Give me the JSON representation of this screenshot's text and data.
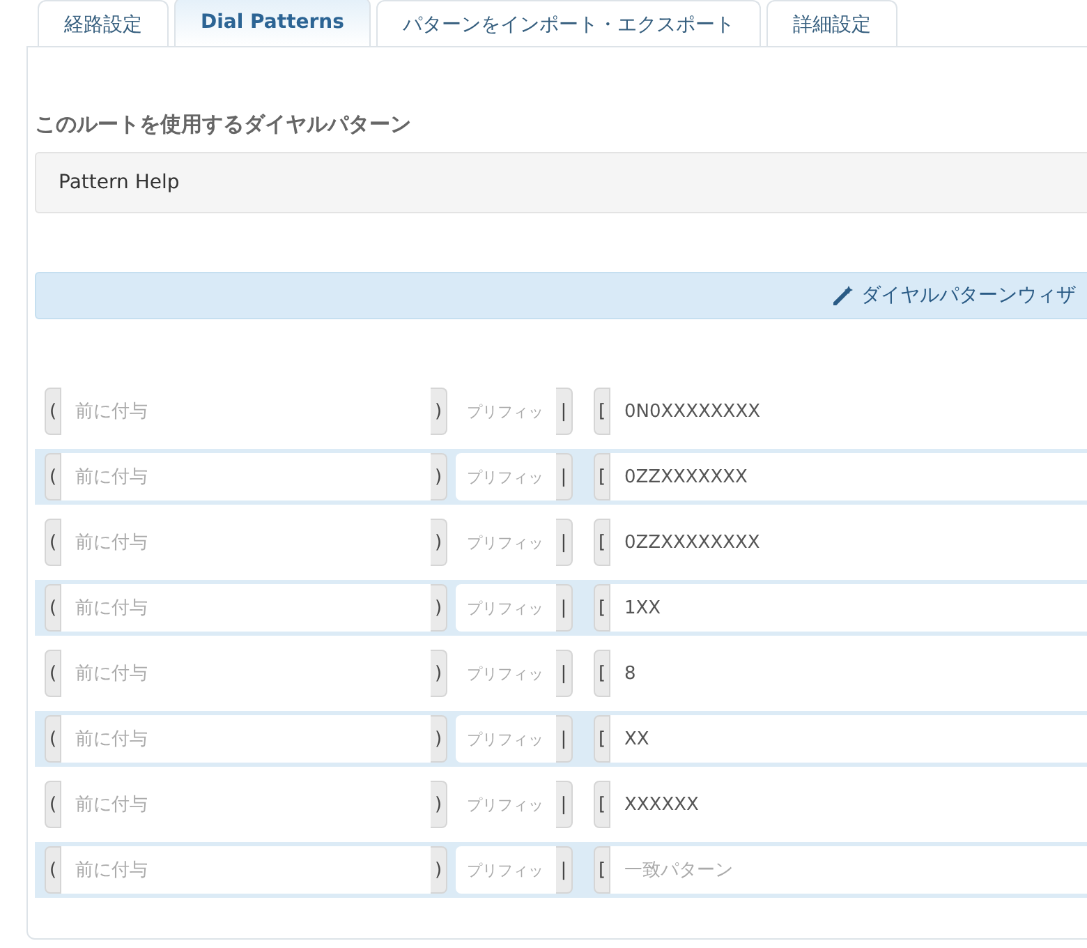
{
  "tabs": [
    {
      "label": "経路設定",
      "selected": false
    },
    {
      "label": "Dial Patterns",
      "selected": true
    },
    {
      "label": "パターンをインポート・エクスポート",
      "selected": false
    },
    {
      "label": "詳細設定",
      "selected": false
    }
  ],
  "heading": "このルートを使用するダイヤルパターン",
  "pattern_help": "Pattern Help",
  "wizard_button": "ダイヤルパターンウィザ",
  "rows": [
    {
      "prepend": {
        "open": "(",
        "placeholder": "前に付与",
        "close": ")"
      },
      "prefix": {
        "placeholder": "プリフィッ",
        "close": "|"
      },
      "match": {
        "open": "[",
        "value": "0N0XXXXXXXX"
      }
    },
    {
      "prepend": {
        "open": "(",
        "placeholder": "前に付与",
        "close": ")"
      },
      "prefix": {
        "placeholder": "プリフィッ",
        "close": "|"
      },
      "match": {
        "open": "[",
        "value": "0ZZXXXXXXX"
      }
    },
    {
      "prepend": {
        "open": "(",
        "placeholder": "前に付与",
        "close": ")"
      },
      "prefix": {
        "placeholder": "プリフィッ",
        "close": "|"
      },
      "match": {
        "open": "[",
        "value": "0ZZXXXXXXXX"
      }
    },
    {
      "prepend": {
        "open": "(",
        "placeholder": "前に付与",
        "close": ")"
      },
      "prefix": {
        "placeholder": "プリフィッ",
        "close": "|"
      },
      "match": {
        "open": "[",
        "value": "1XX"
      }
    },
    {
      "prepend": {
        "open": "(",
        "placeholder": "前に付与",
        "close": ")"
      },
      "prefix": {
        "placeholder": "プリフィッ",
        "close": "|"
      },
      "match": {
        "open": "[",
        "value": "8"
      }
    },
    {
      "prepend": {
        "open": "(",
        "placeholder": "前に付与",
        "close": ")"
      },
      "prefix": {
        "placeholder": "プリフィッ",
        "close": "|"
      },
      "match": {
        "open": "[",
        "value": "XX"
      }
    },
    {
      "prepend": {
        "open": "(",
        "placeholder": "前に付与",
        "close": ")"
      },
      "prefix": {
        "placeholder": "プリフィッ",
        "close": "|"
      },
      "match": {
        "open": "[",
        "value": "XXXXXX"
      }
    },
    {
      "prepend": {
        "open": "(",
        "placeholder": "前に付与",
        "close": ")"
      },
      "prefix": {
        "placeholder": "プリフィッ",
        "close": "|"
      },
      "match": {
        "open": "[",
        "placeholder": "一致パターン"
      }
    }
  ]
}
